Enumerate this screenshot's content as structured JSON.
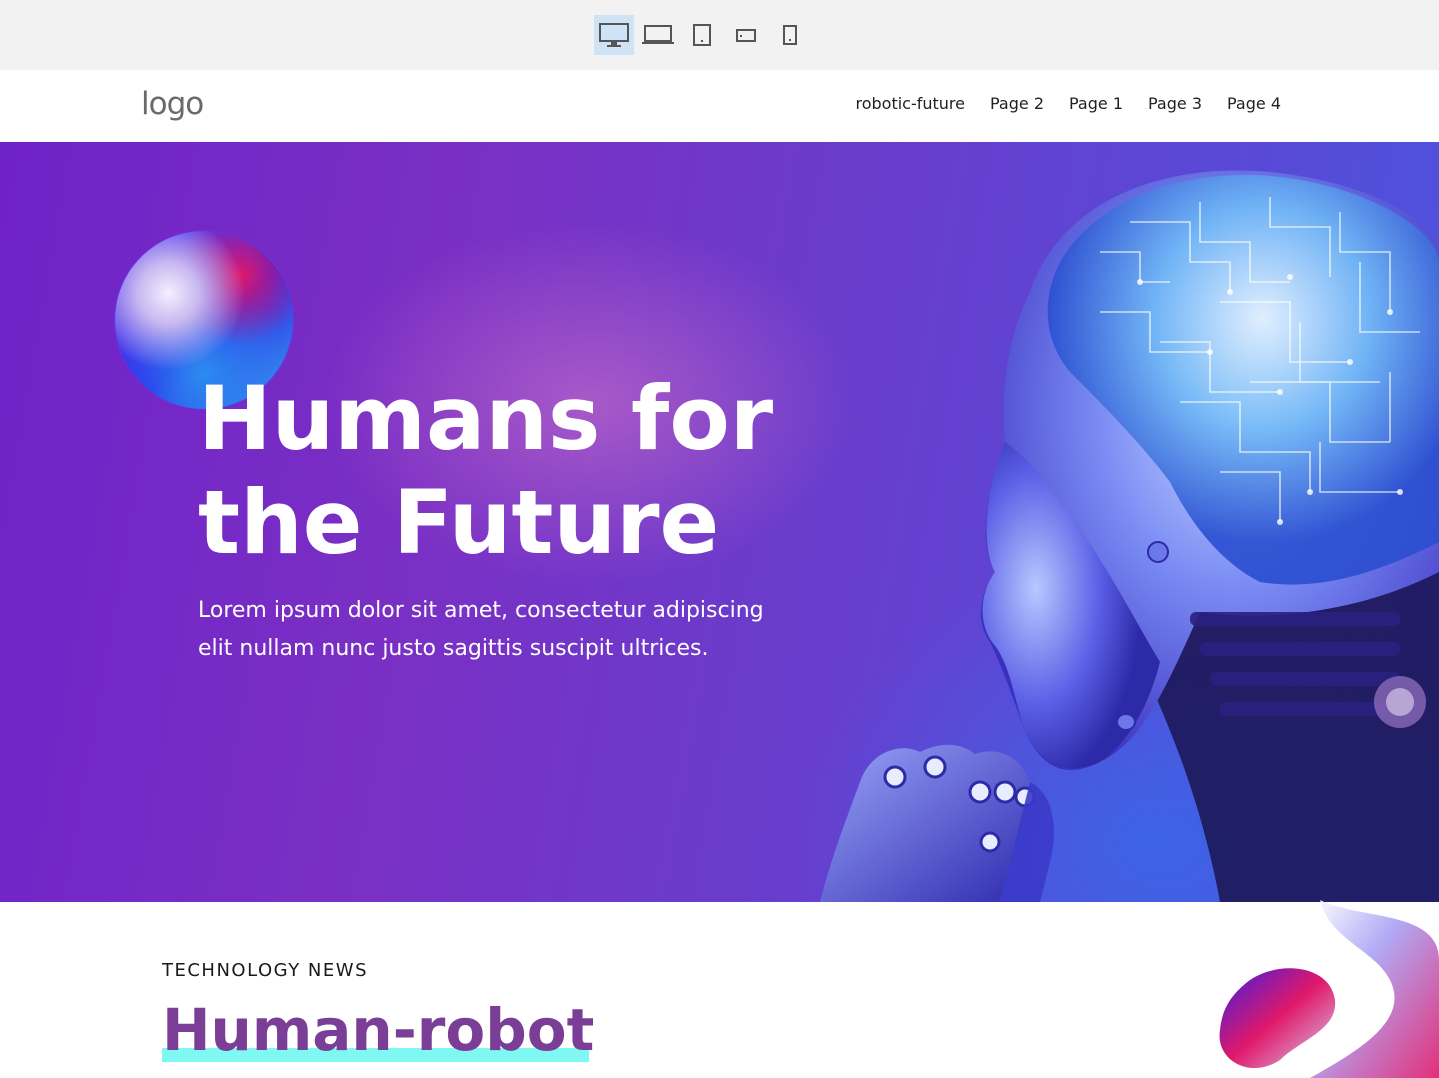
{
  "devices": [
    {
      "name": "desktop",
      "icon": "desktop-icon",
      "active": true
    },
    {
      "name": "laptop",
      "icon": "laptop-icon",
      "active": false
    },
    {
      "name": "tablet",
      "icon": "tablet-icon",
      "active": false
    },
    {
      "name": "tablet-landscape",
      "icon": "tablet-landscape-icon",
      "active": false
    },
    {
      "name": "mobile",
      "icon": "mobile-icon",
      "active": false
    }
  ],
  "header": {
    "logo": "logo",
    "nav": [
      "robotic-future",
      "Page 2",
      "Page 1",
      "Page 3",
      "Page 4"
    ]
  },
  "hero": {
    "title_line1": "Humans for",
    "title_line2": "the Future",
    "text_line1": "Lorem ipsum dolor sit amet, consectetur adipiscing",
    "text_line2": "elit nullam nunc justo sagittis suscipit ultrices."
  },
  "news": {
    "kicker": "TECHNOLOGY NEWS",
    "title": "Human-robot"
  },
  "colors": {
    "accent_purple": "#7b3e97",
    "underline_cyan": "#7ff7f2",
    "active_device_bg": "#cfe3f7"
  }
}
